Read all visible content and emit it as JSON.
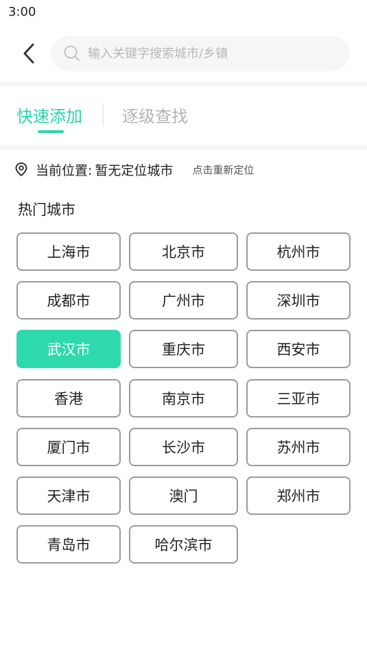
{
  "status_bar": {
    "time": "3:00"
  },
  "search": {
    "placeholder": "输入关键字搜索城市/乡镇",
    "value": ""
  },
  "tabs": [
    {
      "label": "快速添加",
      "active": true
    },
    {
      "label": "逐级查找",
      "active": false
    }
  ],
  "location": {
    "label": "当前位置:",
    "value": "暂无定位城市",
    "relocate_label": "点击重新定位"
  },
  "hot_cities": {
    "title": "热门城市",
    "selected_index": 6,
    "cities": [
      "上海市",
      "北京市",
      "杭州市",
      "成都市",
      "广州市",
      "深圳市",
      "武汉市",
      "重庆市",
      "西安市",
      "香港",
      "南京市",
      "三亚市",
      "厦门市",
      "长沙市",
      "苏州市",
      "天津市",
      "澳门",
      "郑州市",
      "青岛市",
      "哈尔滨市"
    ]
  },
  "colors": {
    "accent": "#2ad4ad",
    "selected_bg": "#2ed9ae",
    "border": "#9a9a9a",
    "inactive_tab": "#b3b3b3",
    "search_bg": "#f6f6f6"
  },
  "icons": {
    "back": "chevron-left-icon",
    "search": "search-icon",
    "location": "location-pin-icon"
  }
}
